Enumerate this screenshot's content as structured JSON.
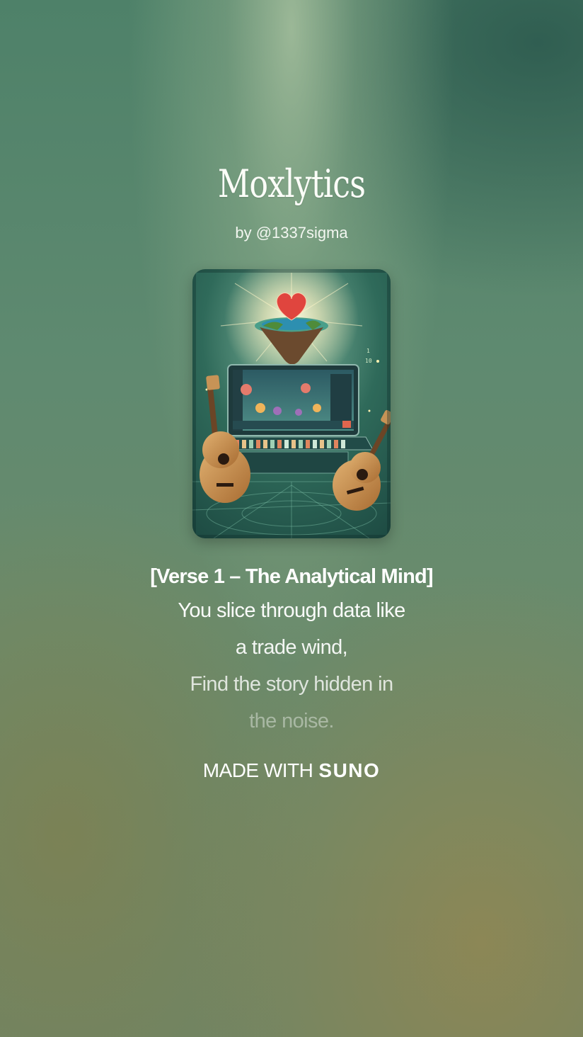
{
  "song": {
    "title": "Moxlytics",
    "byline": "by @1337sigma"
  },
  "lyrics": {
    "section": "[Verse 1 – The Analytical Mind]",
    "lines": [
      "You slice through data like",
      "a trade wind,",
      "Find the story hidden in",
      "the noise."
    ]
  },
  "footer": {
    "made_with": "MADE WITH",
    "brand": "SUNO"
  },
  "cover_art": {
    "icons": [
      "heart-icon",
      "floating-island-icon",
      "laptop-icon",
      "ukulele-icon"
    ]
  },
  "colors": {
    "background_teal": "#4e8169",
    "background_olive": "#8c8558",
    "text": "#ffffff"
  }
}
